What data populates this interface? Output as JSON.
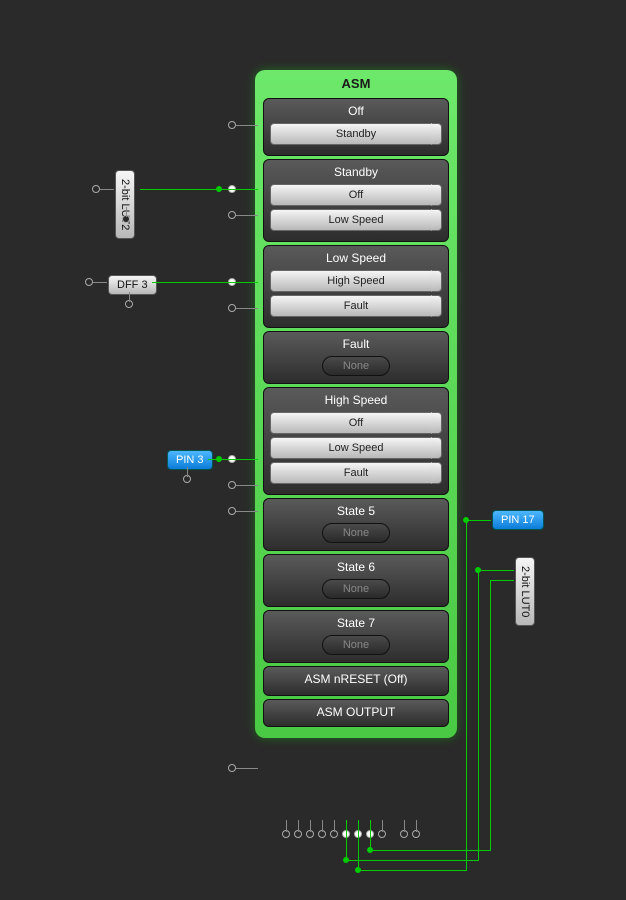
{
  "asm": {
    "title": "ASM",
    "states": [
      {
        "name": "Off",
        "transitions": [
          "Standby"
        ]
      },
      {
        "name": "Standby",
        "transitions": [
          "Off",
          "Low Speed"
        ]
      },
      {
        "name": "Low Speed",
        "transitions": [
          "High Speed",
          "Fault"
        ]
      },
      {
        "name": "Fault",
        "none": "None"
      },
      {
        "name": "High Speed",
        "transitions": [
          "Off",
          "Low Speed",
          "Fault"
        ]
      },
      {
        "name": "State 5",
        "none": "None"
      },
      {
        "name": "State 6",
        "none": "None"
      },
      {
        "name": "State 7",
        "none": "None"
      }
    ],
    "reset": "ASM nRESET (Off)",
    "output": "ASM OUTPUT"
  },
  "nodes": {
    "lut2": "2-bit LUT2",
    "dff3": "DFF 3",
    "pin3": "PIN 3",
    "pin17": "PIN 17",
    "lut0": "2-bit LUT0"
  }
}
